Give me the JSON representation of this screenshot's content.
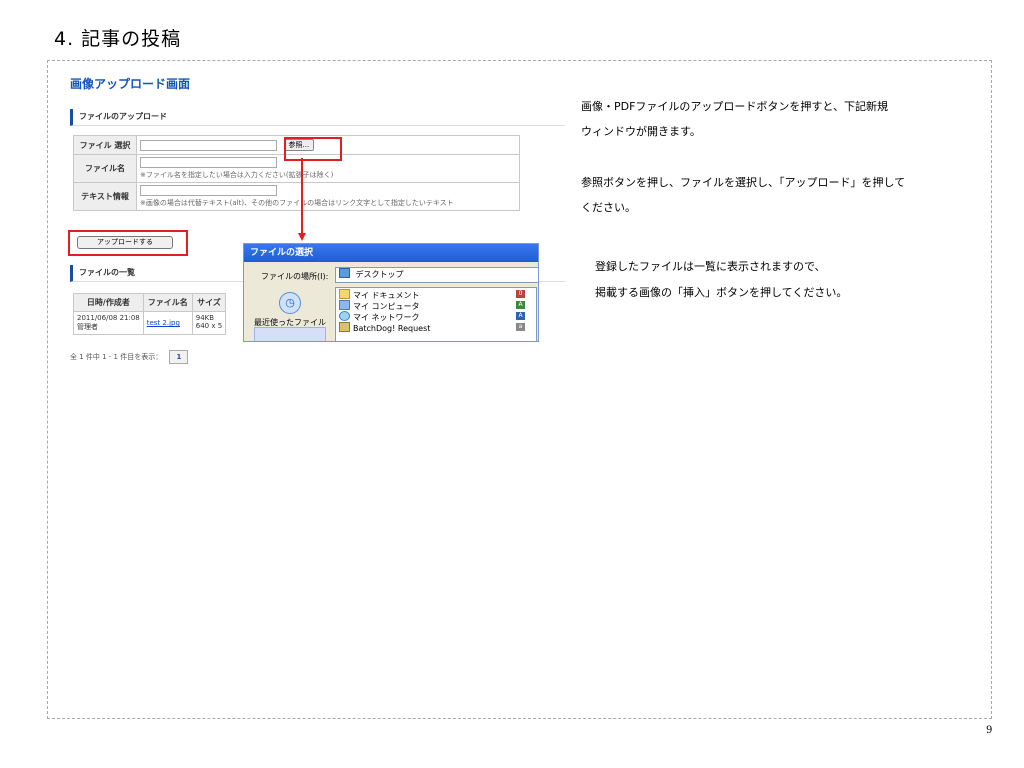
{
  "page": {
    "heading": "4. 記事の投稿",
    "page_number": "9"
  },
  "screenshot": {
    "title": "画像アップロード画面",
    "upload_section": "ファイルのアップロード",
    "form": {
      "file_select_label": "ファイル 選択",
      "browse_button": "参照...",
      "filename_label": "ファイル名",
      "filename_hint": "※ファイル名を指定したい場合は入力ください(拡張子は除く)",
      "text_info_label": "テキスト情報",
      "text_info_hint": "※画像の場合は代替テキスト(alt)、その他のファイルの場合はリンク文字として指定したいテキスト"
    },
    "upload_button": "アップロードする",
    "list_section": "ファイルの一覧",
    "list": {
      "headers": [
        "日時/作成者",
        "ファイル名",
        "サイズ"
      ],
      "rows": [
        {
          "datetime": "2011/06/08 21:08",
          "author": "管理者",
          "filename": "test 2.jpg",
          "size": "94KB",
          "dimensions": "640 x 5"
        }
      ]
    },
    "pager": {
      "summary": "全 1 件中 1 - 1 件目を表示：",
      "current_page": "1"
    }
  },
  "dialog": {
    "title": "ファイルの選択",
    "location_label": "ファイルの場所(I):",
    "location_value": "デスクトップ",
    "recent_label": "最近使ったファイル",
    "items": [
      "マイ ドキュメント",
      "マイ コンピュータ",
      "マイ ネットワーク",
      "BatchDog! Request"
    ],
    "side_letters": [
      "0",
      "A",
      "A",
      "a"
    ]
  },
  "instructions": [
    "画像・PDFファイルのアップロードボタンを押すと、下記新規",
    "ウィンドウが開きます。",
    "参照ボタンを押し、ファイルを選択し、「アップロード」を押して",
    "ください。",
    "登録したファイルは一覧に表示されますので、",
    "掲載する画像の「挿入」ボタンを押してください。"
  ],
  "colors": {
    "accent_blue": "#1155bb",
    "highlight_red": "#e02020",
    "frame_border": "#a9a9a9"
  }
}
